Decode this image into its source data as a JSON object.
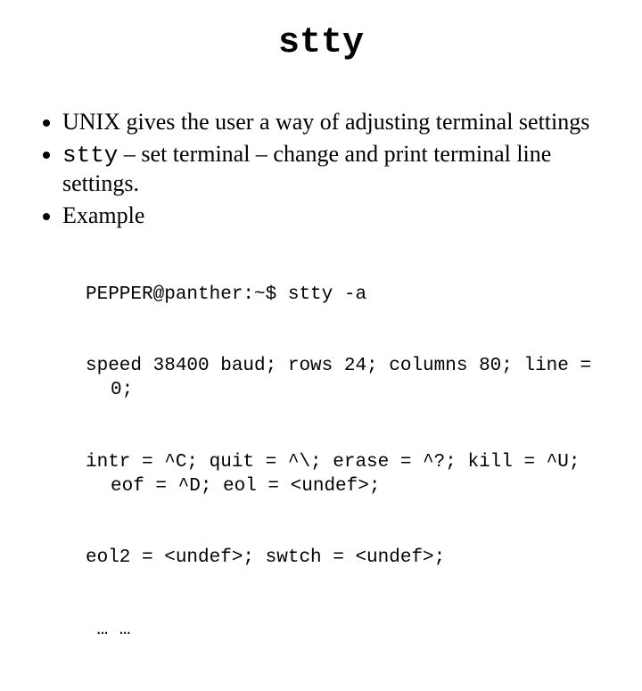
{
  "title": "stty",
  "bullets": {
    "b1": "UNIX gives the user a way of adjusting terminal settings",
    "b2_cmd": "stty",
    "b2_rest": " – set terminal – change and print terminal line settings.",
    "b3": "Example"
  },
  "example": {
    "l1": "PEPPER@panther:~$ stty -a",
    "l2": "speed 38400 baud; rows 24; columns 80; line = 0;",
    "l3": "intr = ^C; quit = ^\\; erase = ^?; kill = ^U; eof = ^D; eol = <undef>;",
    "l4": "eol2 = <undef>; swtch = <undef>;",
    "l5": " … …"
  }
}
